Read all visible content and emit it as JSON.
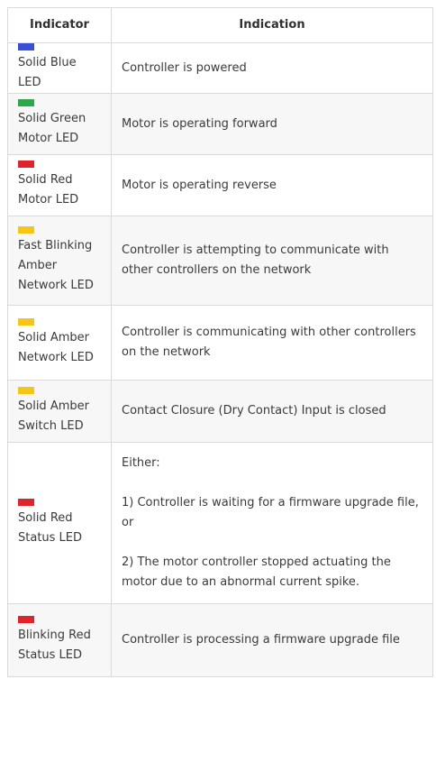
{
  "table": {
    "headers": {
      "indicator": "Indicator",
      "indication": "Indication"
    },
    "rows": [
      {
        "led_color": "#3a4fd6",
        "indicator": "Solid Blue LED",
        "indication": [
          "Controller is powered"
        ]
      },
      {
        "led_color": "#2ea84a",
        "indicator": "Solid Green Motor LED",
        "indication": [
          "Motor is operating forward"
        ]
      },
      {
        "led_color": "#e0242c",
        "indicator": "Solid Red Motor LED",
        "indication": [
          "Motor is operating reverse"
        ]
      },
      {
        "led_color": "#f5c518",
        "indicator": "Fast Blinking Amber Network LED",
        "indication": [
          "Controller is attempting to communicate with other controllers on the network"
        ]
      },
      {
        "led_color": "#f5c518",
        "indicator": "Solid Amber Network LED",
        "indication": [
          "Controller is communicating with other controllers on the network"
        ]
      },
      {
        "led_color": "#f5c518",
        "indicator": "Solid Amber Switch LED",
        "indication": [
          "Contact Closure (Dry Contact) Input is closed"
        ]
      },
      {
        "led_color": "#e0242c",
        "indicator": "Solid Red Status LED",
        "indication": [
          "Either:",
          "1) Controller is waiting for a firmware upgrade file, or",
          "2) The motor controller stopped actuating the motor due to an abnormal current spike."
        ]
      },
      {
        "led_color": "#e0242c",
        "indicator": "Blinking Red Status LED",
        "indication": [
          "Controller is processing a firmware upgrade file"
        ]
      }
    ]
  }
}
